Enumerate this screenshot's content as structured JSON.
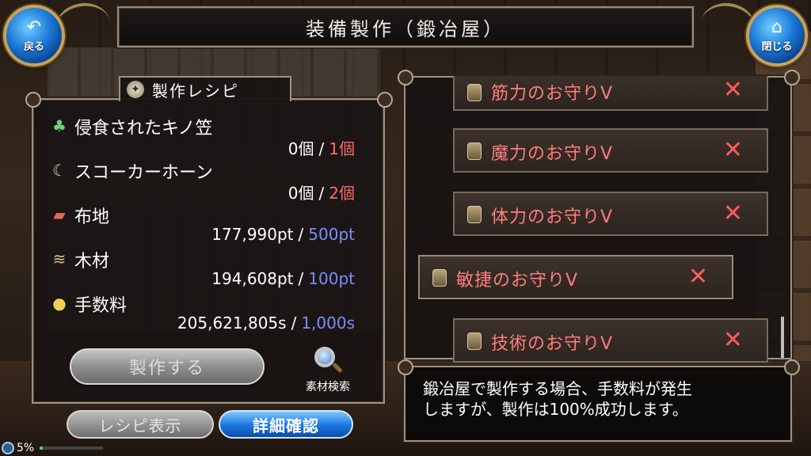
{
  "header": {
    "title": "装備製作（鍛冶屋）",
    "back_label": "戻る",
    "close_label": "閉じる"
  },
  "recipe": {
    "tab_title": "製作レシピ",
    "materials": [
      {
        "name": "侵食されたキノ笠",
        "have": "0個",
        "need": "1個",
        "icon": "mushroom-icon",
        "need_color": "red"
      },
      {
        "name": "スコーカーホーン",
        "have": "0個",
        "need": "2個",
        "icon": "horn-icon",
        "need_color": "red"
      },
      {
        "name": "布地",
        "have": "177,990pt",
        "need": "500pt",
        "icon": "cloth-icon",
        "need_color": "blue"
      },
      {
        "name": "木材",
        "have": "194,608pt",
        "need": "100pt",
        "icon": "wood-icon",
        "need_color": "blue"
      },
      {
        "name": "手数料",
        "have": "205,621,805s",
        "need": "1,000s",
        "icon": "coins-icon",
        "need_color": "blue"
      }
    ],
    "separator": "/",
    "craft_button": "製作する",
    "search_label": "素材検索"
  },
  "bottom_buttons": {
    "recipe_view": "レシピ表示",
    "detail_check": "詳細確認"
  },
  "list": {
    "items": [
      {
        "name": "筋力のお守りV",
        "mark": "✕"
      },
      {
        "name": "魔力のお守りV",
        "mark": "✕"
      },
      {
        "name": "体力のお守りV",
        "mark": "✕"
      },
      {
        "name": "敏捷のお守りV",
        "mark": "✕"
      },
      {
        "name": "技術のお守りV",
        "mark": "✕"
      }
    ]
  },
  "description": {
    "line1": "鍛冶屋で製作する場合、手数料が発生",
    "line2": "しますが、製作は100%成功します。"
  },
  "status": {
    "battery": "5%",
    "battery_level": 0.05
  },
  "colors": {
    "accent_blue": "#1a74e0",
    "required_red": "#ff6a6a",
    "required_blue": "#7a8cff",
    "item_name_red": "#ff7d7d"
  }
}
